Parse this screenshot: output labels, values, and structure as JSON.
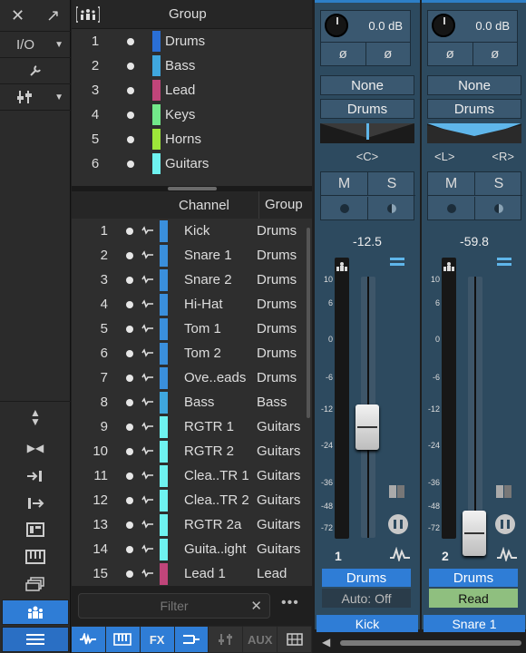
{
  "left_toolbar": {
    "io_label": "I/O"
  },
  "group_panel": {
    "header": "Group",
    "groups": [
      {
        "num": "1",
        "name": "Drums",
        "color": "#2a6fd6"
      },
      {
        "num": "2",
        "name": "Bass",
        "color": "#3fa7de"
      },
      {
        "num": "3",
        "name": "Lead",
        "color": "#c0457a"
      },
      {
        "num": "4",
        "name": "Keys",
        "color": "#72e88a"
      },
      {
        "num": "5",
        "name": "Horns",
        "color": "#9de63a"
      },
      {
        "num": "6",
        "name": "Guitars",
        "color": "#6ef2f0"
      }
    ]
  },
  "channel_panel": {
    "col_channel": "Channel",
    "col_group": "Group",
    "channels": [
      {
        "num": "1",
        "name": "Kick",
        "group": "Drums",
        "color": "#3a8fdc"
      },
      {
        "num": "2",
        "name": "Snare 1",
        "group": "Drums",
        "color": "#3a8fdc"
      },
      {
        "num": "3",
        "name": "Snare 2",
        "group": "Drums",
        "color": "#3a8fdc"
      },
      {
        "num": "4",
        "name": "Hi-Hat",
        "group": "Drums",
        "color": "#3a8fdc"
      },
      {
        "num": "5",
        "name": "Tom 1",
        "group": "Drums",
        "color": "#3a8fdc"
      },
      {
        "num": "6",
        "name": "Tom 2",
        "group": "Drums",
        "color": "#3a8fdc"
      },
      {
        "num": "7",
        "name": "Ove..eads",
        "group": "Drums",
        "color": "#3a8fdc"
      },
      {
        "num": "8",
        "name": "Bass",
        "group": "Bass",
        "color": "#3fa7de"
      },
      {
        "num": "9",
        "name": "RGTR 1",
        "group": "Guitars",
        "color": "#6ef2f0"
      },
      {
        "num": "10",
        "name": "RGTR 2",
        "group": "Guitars",
        "color": "#6ef2f0"
      },
      {
        "num": "11",
        "name": "Clea..TR 1",
        "group": "Guitars",
        "color": "#6ef2f0"
      },
      {
        "num": "12",
        "name": "Clea..TR 2",
        "group": "Guitars",
        "color": "#6ef2f0"
      },
      {
        "num": "13",
        "name": "RGTR 2a",
        "group": "Guitars",
        "color": "#6ef2f0"
      },
      {
        "num": "14",
        "name": "Guita..ight",
        "group": "Guitars",
        "color": "#6ef2f0"
      },
      {
        "num": "15",
        "name": "Lead 1",
        "group": "Lead",
        "color": "#c0457a"
      }
    ],
    "filter_placeholder": "Filter",
    "more": "•••"
  },
  "bottom_bar": {
    "fx": "FX",
    "aux": "AUX"
  },
  "strips": [
    {
      "gain": "0.0 dB",
      "phase_a": "ø",
      "phase_b": "ø",
      "input": "None",
      "output": "Drums",
      "pan_left": "<C>",
      "pan_right": "",
      "mute": "M",
      "solo": "S",
      "volume": "-12.5",
      "fader_level_db": -12.5,
      "channel_number": "1",
      "group_badge": "Drums",
      "automation": "Auto: Off",
      "name": "Kick"
    },
    {
      "gain": "0.0 dB",
      "phase_a": "ø",
      "phase_b": "ø",
      "input": "None",
      "output": "Drums",
      "pan_left": "<L>",
      "pan_right": "<R>",
      "mute": "M",
      "solo": "S",
      "volume": "-59.8",
      "fader_level_db": -59.8,
      "channel_number": "2",
      "group_badge": "Drums",
      "automation": "Read",
      "name": "Snare 1"
    }
  ],
  "meter_scale": [
    "10",
    "6",
    "0",
    "-6",
    "-12",
    "-24",
    "-36",
    "-48",
    "-72"
  ],
  "colors": {
    "accent": "#2f7dd6",
    "strip_bg": "#2d4a5f",
    "read_bg": "#8fbf7f"
  }
}
